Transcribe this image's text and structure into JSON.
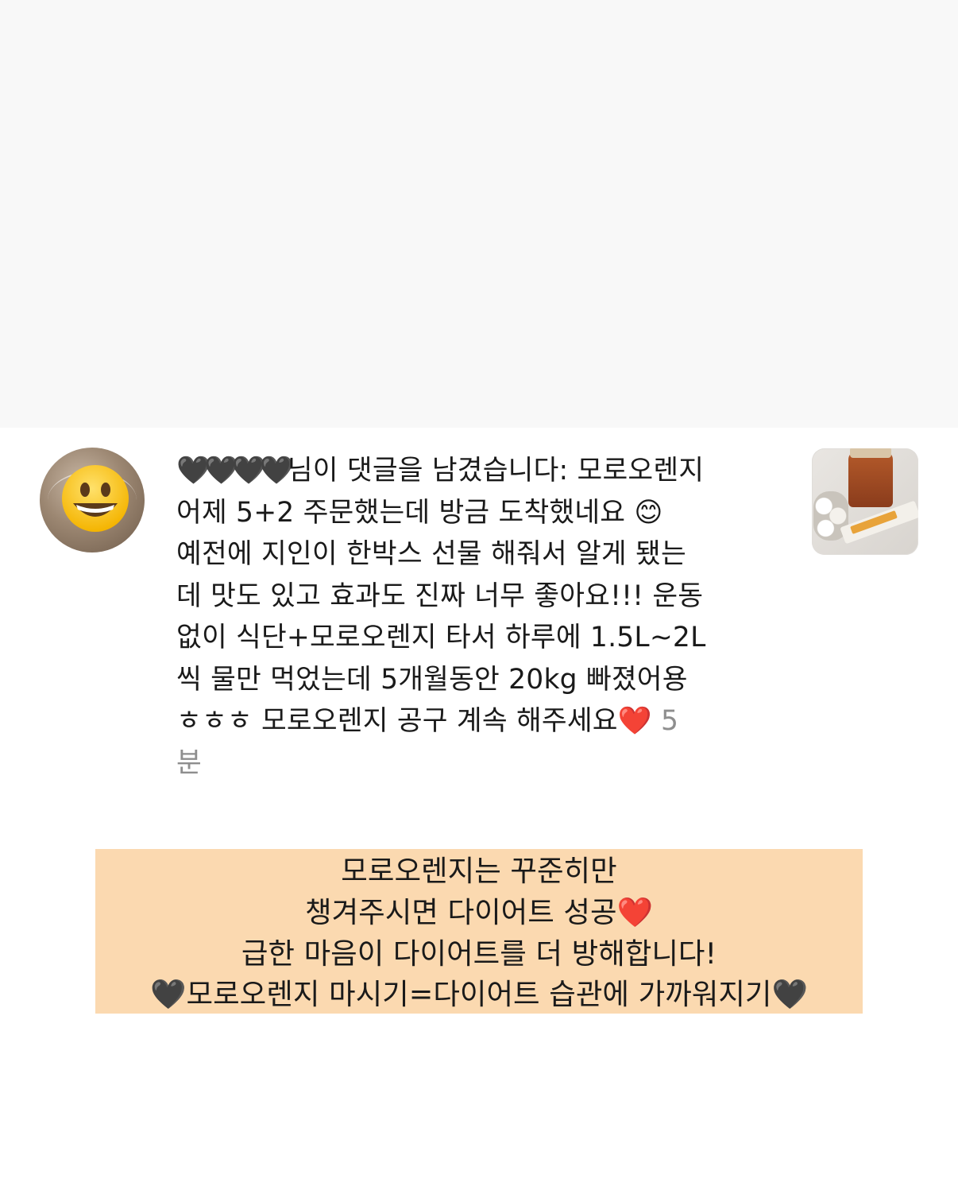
{
  "notification": {
    "username": "🖤🖤🖤🖤",
    "comment_text": "님이 댓글을 남겼습니다: 모로오렌지\n어제 5+2 주문했는데 방금 도착했네요 😊\n예전에 지인이 한박스 선물 해줘서 알게 됐는\n데 맛도 있고 효과도 진짜 너무 좋아요!!! 운동\n없이 식단+모로오렌지 타서 하루에 1.5L~2L\n씩 물만 먹었는데 5개월동안 20kg 빠졌어용\nㅎㅎㅎ 모로오렌지 공구 계속 해주세요❤️ ",
    "timestamp_line1": "5",
    "timestamp_line2": "분"
  },
  "banner": {
    "lines": [
      "모로오렌지는 꾸준히만",
      "챙겨주시면 다이어트 성공❤️",
      "급한 마음이 다이어트를 더 방해합니다!",
      "🖤모로오렌지 마시기=다이어트 습관에 가까워지기🖤"
    ]
  },
  "icons": {
    "avatar_overlay": "grinning-face-emoji",
    "thumbnail": "product-photo"
  },
  "colors": {
    "top_background": "#f8f8f8",
    "banner_background": "#fbd9b0",
    "timestamp_text": "#8e8e8e"
  }
}
